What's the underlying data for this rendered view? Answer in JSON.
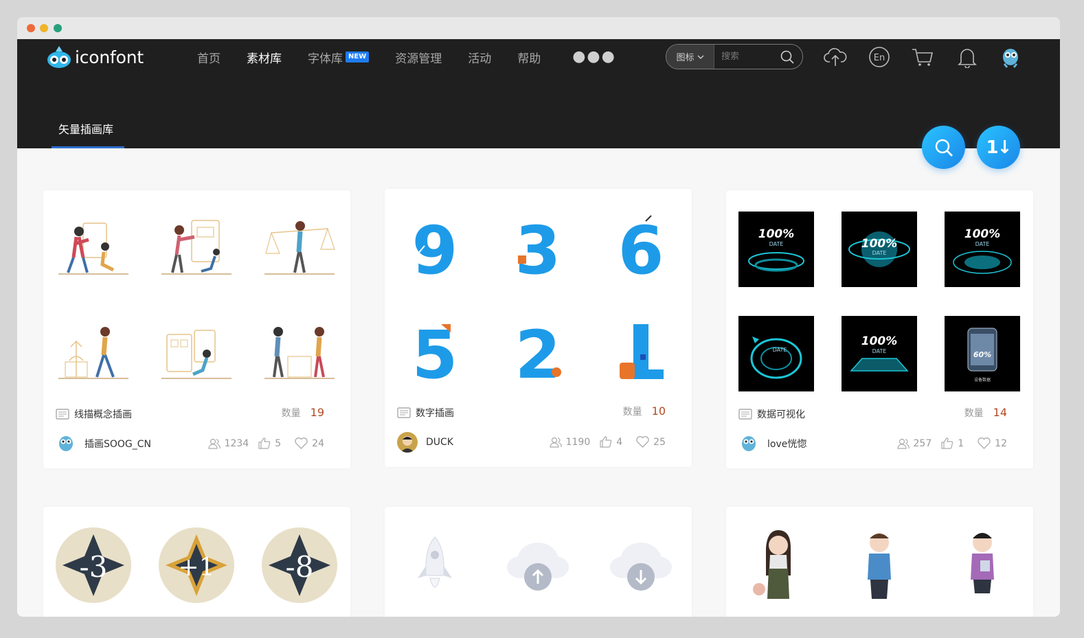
{
  "header": {
    "logo_text": "iconfont",
    "nav": [
      {
        "label": "首页"
      },
      {
        "label": "素材库"
      },
      {
        "label": "字体库",
        "badge": "NEW"
      },
      {
        "label": "资源管理"
      },
      {
        "label": "活动"
      },
      {
        "label": "帮助"
      }
    ],
    "more_icon": "more-dots-icon",
    "search": {
      "type_label": "图标",
      "placeholder": "搜索"
    },
    "icons": [
      "upload-cloud-icon",
      "language-en-icon",
      "cart-icon",
      "bell-icon",
      "user-avatar-icon"
    ],
    "lang_label": "En"
  },
  "subnav": {
    "label": "矢量插画库"
  },
  "fabs": {
    "sort_label": "1↓"
  },
  "cards": [
    {
      "title": "线描概念插画",
      "count_label": "数量",
      "count": "19",
      "author": "插画SOOG_CN",
      "views": "1234",
      "likes": "5",
      "favorites": "24"
    },
    {
      "title": "数字插画",
      "count_label": "数量",
      "count": "10",
      "author": "DUCK",
      "views": "1190",
      "likes": "4",
      "favorites": "25"
    },
    {
      "title": "数据可视化",
      "count_label": "数量",
      "count": "14",
      "author": "love恍惚",
      "views": "257",
      "likes": "1",
      "favorites": "12"
    }
  ],
  "numbers_card": {
    "digits": [
      "9",
      "3",
      "6",
      "5",
      "2",
      "1"
    ]
  },
  "dataviz_card": {
    "thumb_texts": [
      "100%",
      "DATE",
      "60%",
      "设备数据"
    ]
  },
  "badge_card": {
    "labels": [
      "-3",
      "+1",
      "-8"
    ]
  },
  "colors": {
    "header_bg": "#1f1f1f",
    "accent": "#1a86e8",
    "count_color": "#b24a22",
    "new_badge": "#1e7cf2"
  }
}
